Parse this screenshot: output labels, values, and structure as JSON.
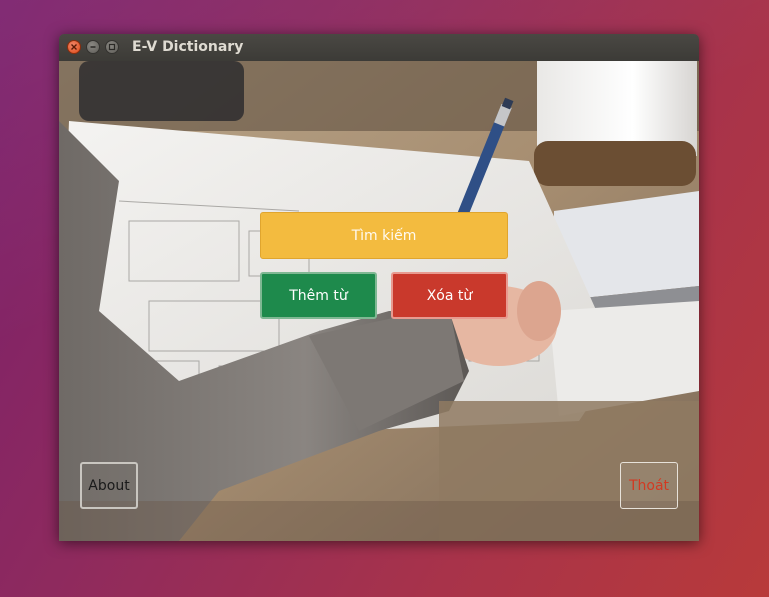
{
  "window": {
    "title": "E-V Dictionary"
  },
  "buttons": {
    "search_label": "Tìm kiếm",
    "add_label": "Thêm từ",
    "delete_label": "Xóa từ",
    "about_label": "About",
    "exit_label": "Thoát"
  },
  "colors": {
    "search": "#f3bb3f",
    "add": "#1e8a4c",
    "delete": "#c9392c",
    "exit_text": "#d23a22",
    "titlebar": "#3c3b37"
  }
}
